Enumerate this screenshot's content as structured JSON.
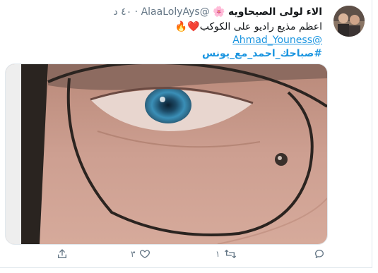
{
  "tweet": {
    "display_name": "الاء لولى الصيحاويه",
    "name_emoji": "🌸",
    "handle": "@AlaaLolyAys",
    "separator": "·",
    "time": "٤٠ د",
    "line1_text": "اعظم مذيع راديو على الكوكب",
    "line1_emojis": "❤️🔥",
    "mention": "@Ahmad_Youness",
    "hashtag": "#صباحك_احمد_مع_يونس"
  },
  "actions": {
    "reply_count": "",
    "retweet_count": "١",
    "like_count": "٣",
    "share_count": ""
  },
  "icons": [
    "avatar-photo",
    "reply-icon",
    "retweet-icon",
    "like-icon",
    "share-icon"
  ],
  "colors": {
    "link": "#1b95e0",
    "muted": "#657786",
    "iris": "#3a8fb7"
  }
}
